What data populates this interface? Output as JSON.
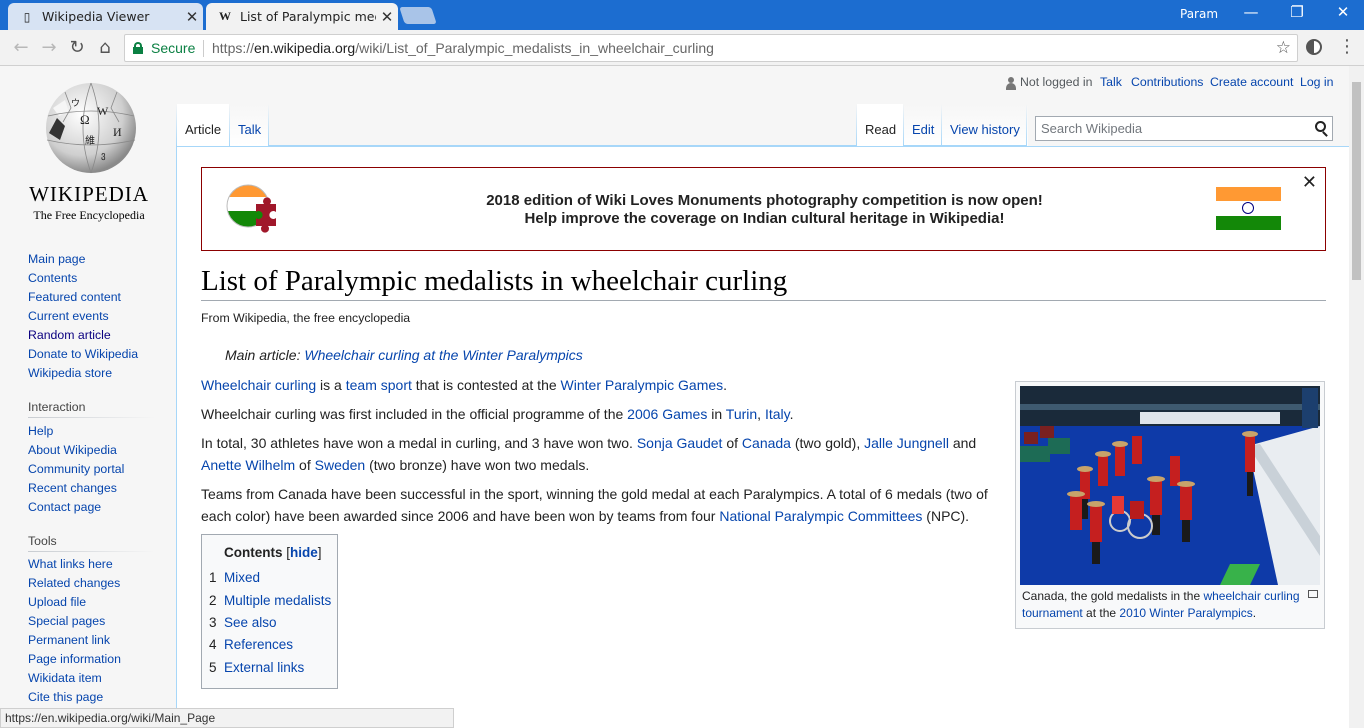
{
  "browser": {
    "tabs": [
      {
        "label": "Wikipedia Viewer",
        "icon": "page-icon",
        "active": false
      },
      {
        "label": "List of Paralympic medalis",
        "icon": "wikipedia-w-icon",
        "active": true
      }
    ],
    "user": "Param",
    "address": {
      "secure_label": "Secure",
      "scheme": "https://",
      "host": "en.wikipedia.org",
      "path": "/wiki/List_of_Paralympic_medalists_in_wheelchair_curling"
    },
    "status_url": "https://en.wikipedia.org/wiki/Main_Page"
  },
  "wiki": {
    "logo": {
      "wordmark": "WIKIPEDIA",
      "tagline": "The Free Encyclopedia"
    },
    "personal": {
      "not_logged_in": "Not logged in",
      "talk": "Talk",
      "contributions": "Contributions",
      "create_account": "Create account",
      "log_in": "Log in"
    },
    "tabs": {
      "article": "Article",
      "talk": "Talk",
      "read": "Read",
      "edit": "Edit",
      "history": "View history"
    },
    "search_placeholder": "Search Wikipedia",
    "sidebar": {
      "navigation": [
        "Main page",
        "Contents",
        "Featured content",
        "Current events",
        "Random article",
        "Donate to Wikipedia",
        "Wikipedia store"
      ],
      "interaction_heading": "Interaction",
      "interaction": [
        "Help",
        "About Wikipedia",
        "Community portal",
        "Recent changes",
        "Contact page"
      ],
      "tools_heading": "Tools",
      "tools": [
        "What links here",
        "Related changes",
        "Upload file",
        "Special pages",
        "Permanent link",
        "Page information",
        "Wikidata item",
        "Cite this page"
      ]
    },
    "banner": {
      "line1": "2018 edition of Wiki Loves Monuments photography competition is now open!",
      "line2": "Help improve the coverage on Indian cultural heritage in Wikipedia!",
      "flag_colors": [
        "#ff9933",
        "#ffffff",
        "#138808"
      ],
      "chakra_color": "#000080"
    },
    "article": {
      "title": "List of Paralympic medalists in wheelchair curling",
      "tagline": "From Wikipedia, the free encyclopedia",
      "hatnote_prefix": "Main article: ",
      "hatnote_link": "Wheelchair curling at the Winter Paralympics",
      "p1": {
        "a": "Wheelchair curling",
        "b": " is a ",
        "c": "team sport",
        "d": " that is contested at the ",
        "e": "Winter Paralympic Games",
        "f": "."
      },
      "p2": {
        "a": "Wheelchair curling was first included in the official programme of the ",
        "b": "2006 Games",
        "c": " in ",
        "d": "Turin",
        "e": ", ",
        "f": "Italy",
        "g": "."
      },
      "p3": {
        "a": "In total, 30 athletes have won a medal in curling, and 3 have won two. ",
        "b": "Sonja Gaudet",
        "c": " of ",
        "d": "Canada",
        "e": " (two gold), ",
        "f": "Jalle Jungnell",
        "g": " and",
        "h": "Anette Wilhelm",
        "i": " of ",
        "j": "Sweden",
        "k": " (two bronze) have won two medals."
      },
      "p4": {
        "a": "Teams from Canada have been successful in the sport, winning the gold medal at each Paralympics. A total of 6 medals (two of",
        "b": "each color) have been awarded since 2006 and have been won by teams from four ",
        "c": "National Paralympic Committees",
        "d": " (NPC)."
      }
    },
    "toc": {
      "title": "Contents",
      "hide_open": " [",
      "hide": "hide",
      "hide_close": "]",
      "items": [
        {
          "num": "1",
          "label": "Mixed"
        },
        {
          "num": "2",
          "label": "Multiple medalists"
        },
        {
          "num": "3",
          "label": "See also"
        },
        {
          "num": "4",
          "label": "References"
        },
        {
          "num": "5",
          "label": "External links"
        }
      ]
    },
    "thumb": {
      "cap_a": "Canada, the gold medalists in the ",
      "cap_link1": "wheelchair curling tournament",
      "cap_b": " at the ",
      "cap_link2": "2010 Winter Paralympics",
      "cap_c": "."
    }
  }
}
